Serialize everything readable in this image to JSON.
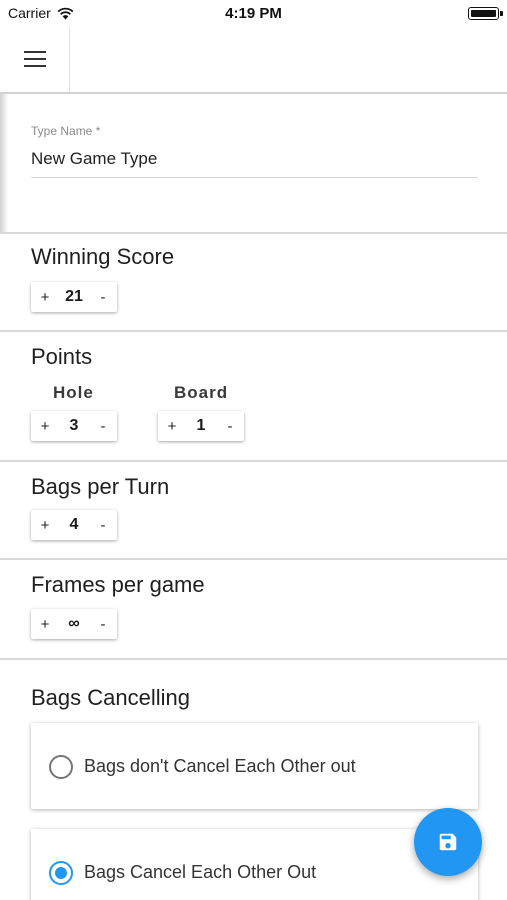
{
  "status_bar": {
    "carrier": "Carrier",
    "time": "4:19 PM"
  },
  "form": {
    "type_name": {
      "label": "Type Name *",
      "value": "New Game Type"
    },
    "winning_score": {
      "title": "Winning Score",
      "plus": "+",
      "value": "21",
      "minus": "-"
    },
    "points": {
      "title": "Points",
      "hole": {
        "label": "Hole",
        "plus": "+",
        "value": "3",
        "minus": "-"
      },
      "board": {
        "label": "Board",
        "plus": "+",
        "value": "1",
        "minus": "-"
      }
    },
    "bags_per_turn": {
      "title": "Bags per Turn",
      "plus": "+",
      "value": "4",
      "minus": "-"
    },
    "frames_per_game": {
      "title": "Frames per game",
      "plus": "+",
      "value": "∞",
      "minus": "-"
    },
    "bags_cancelling": {
      "title": "Bags Cancelling",
      "options": [
        {
          "label": "Bags don't Cancel Each Other out",
          "selected": false
        },
        {
          "label": "Bags Cancel Each Other Out",
          "selected": true
        }
      ]
    }
  },
  "icons": {
    "menu": "hamburger-menu-icon",
    "save": "save-floppy-icon",
    "wifi": "wifi-icon",
    "battery": "battery-icon"
  },
  "colors": {
    "accent": "#2196f3",
    "divider": "#d9d9d9"
  }
}
